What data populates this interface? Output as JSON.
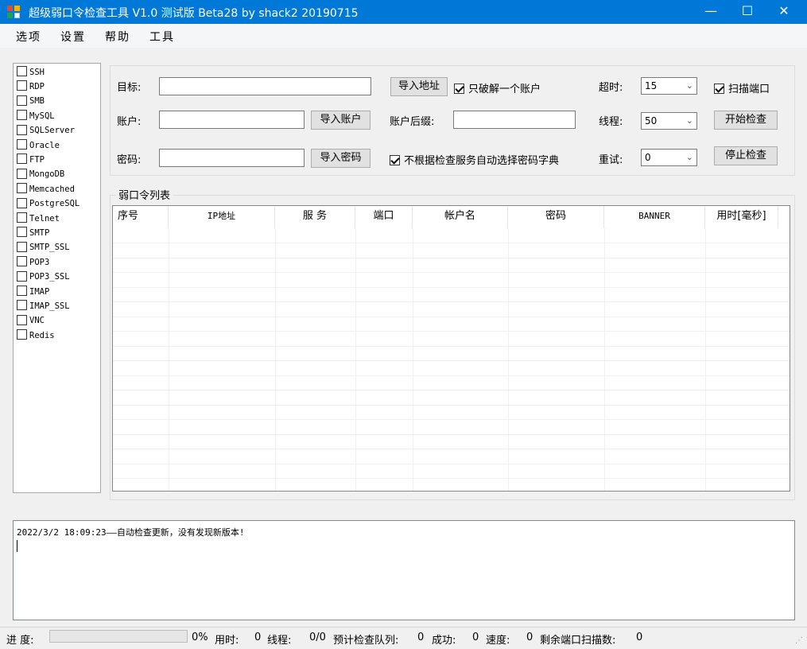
{
  "window": {
    "title": "超级弱口令检查工具 V1.0 测试版 Beta28 by shack2 20190715",
    "minimize_glyph": "—",
    "maximize_glyph": "☐",
    "close_glyph": "✕"
  },
  "menu": [
    "选项",
    "设置",
    "帮助",
    "工具"
  ],
  "protocols": [
    {
      "label": "SSH",
      "checked": false
    },
    {
      "label": "RDP",
      "checked": false
    },
    {
      "label": "SMB",
      "checked": false
    },
    {
      "label": "MySQL",
      "checked": false
    },
    {
      "label": "SQLServer",
      "checked": false
    },
    {
      "label": "Oracle",
      "checked": false
    },
    {
      "label": "FTP",
      "checked": false
    },
    {
      "label": "MongoDB",
      "checked": false
    },
    {
      "label": "Memcached",
      "checked": false
    },
    {
      "label": "PostgreSQL",
      "checked": false
    },
    {
      "label": "Telnet",
      "checked": false
    },
    {
      "label": "SMTP",
      "checked": false
    },
    {
      "label": "SMTP_SSL",
      "checked": false
    },
    {
      "label": "POP3",
      "checked": false
    },
    {
      "label": "POP3_SSL",
      "checked": false
    },
    {
      "label": "IMAP",
      "checked": false
    },
    {
      "label": "IMAP_SSL",
      "checked": false
    },
    {
      "label": "VNC",
      "checked": false
    },
    {
      "label": "Redis",
      "checked": false
    }
  ],
  "config": {
    "target_label": "目标:",
    "target_value": "",
    "import_address": "导入地址",
    "crack_one_label": "只破解一个账户",
    "crack_one_checked": true,
    "timeout_label": "超时:",
    "timeout_value": "15",
    "scan_port_label": "扫描端口",
    "scan_port_checked": true,
    "account_label": "账户:",
    "account_value": "",
    "import_account": "导入账户",
    "suffix_label": "账户后缀:",
    "suffix_value": "",
    "threads_label": "线程:",
    "threads_value": "50",
    "start_check": "开始检查",
    "password_label": "密码:",
    "password_value": "",
    "import_password": "导入密码",
    "auto_dict_label": "不根据检查服务自动选择密码字典",
    "auto_dict_checked": true,
    "retry_label": "重试:",
    "retry_value": "0",
    "stop_check": "停止检查"
  },
  "weak_list": {
    "title": "弱口令列表",
    "columns": [
      "序号",
      "IP地址",
      "服 务",
      "端口",
      "帐户名",
      "密码",
      "BANNER",
      "用时[毫秒]"
    ],
    "rows": []
  },
  "log": {
    "text": "2022/3/2 18:09:23——自动检查更新，没有发现新版本!"
  },
  "status": {
    "progress_label": "进 度:",
    "progress_value": 0,
    "progress_text": "0%",
    "time_label": "用时:",
    "time_value": "0",
    "threads_label": "线程:",
    "threads_value": "0/0",
    "queue_label": "预计检查队列:",
    "queue_value": "0",
    "success_label": "成功:",
    "success_value": "0",
    "speed_label": "速度:",
    "speed_value": "0",
    "ports_label": "剩余端口扫描数:",
    "ports_value": "0"
  },
  "colors": {
    "titlebar": "#0078d7",
    "progress_fill": "#06b025"
  }
}
